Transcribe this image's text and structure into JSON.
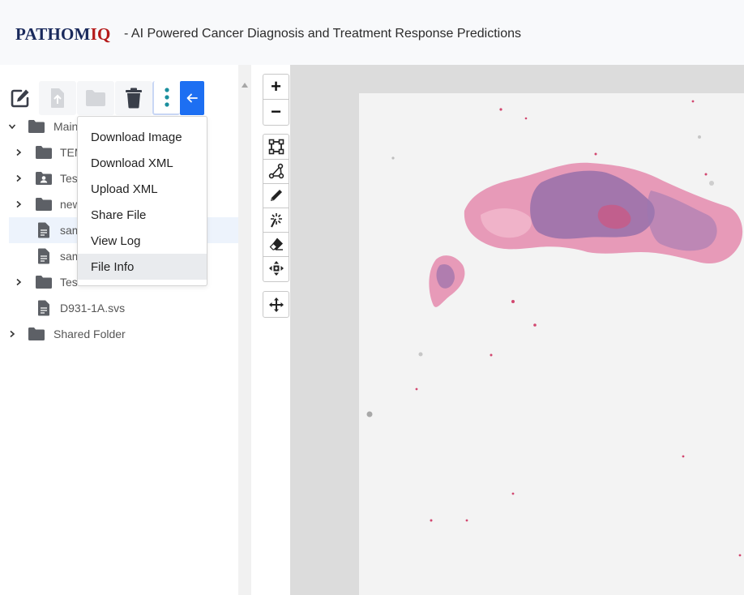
{
  "header": {
    "brand_part1": "PATHOM",
    "brand_part2": "IQ",
    "tagline": "- AI Powered Cancer Diagnosis and Treatment Response Predictions"
  },
  "toolbar": {
    "buttons": [
      {
        "name": "edit",
        "icon": "edit-icon",
        "enabled": true
      },
      {
        "name": "upload",
        "icon": "upload-file-icon",
        "enabled": false
      },
      {
        "name": "new-folder",
        "icon": "folder-icon",
        "enabled": false
      },
      {
        "name": "delete",
        "icon": "trash-icon",
        "enabled": true
      },
      {
        "name": "more",
        "icon": "vertical-dots-icon",
        "enabled": true
      },
      {
        "name": "collapse",
        "icon": "arrow-left-icon",
        "enabled": true
      }
    ]
  },
  "tree": {
    "items": [
      {
        "label": "Main",
        "type": "folder",
        "expanded": true
      },
      {
        "label": "TEM",
        "type": "folder"
      },
      {
        "label": "Tes",
        "type": "shared-folder"
      },
      {
        "label": "new",
        "type": "folder"
      },
      {
        "label": "sam",
        "type": "file",
        "selected": true
      },
      {
        "label": "sam",
        "type": "file"
      },
      {
        "label": "Test",
        "type": "folder"
      },
      {
        "label": "D931-1A.svs",
        "type": "file"
      },
      {
        "label": "Shared Folder",
        "type": "folder"
      }
    ]
  },
  "context_menu": {
    "items": [
      "Download Image",
      "Download XML",
      "Upload XML",
      "Share File",
      "View Log",
      "File Info"
    ],
    "highlighted": "File Info"
  },
  "viewer": {
    "zoom_in": "+",
    "zoom_out": "−",
    "tools": [
      "rectangle-tool-icon",
      "polygon-tool-icon",
      "pencil-icon",
      "magic-wand-icon",
      "eraser-icon",
      "move-points-icon"
    ],
    "pan": "pan-icon"
  },
  "colors": {
    "brand_navy": "#1a2a5c",
    "brand_red": "#b51b1b",
    "accent_blue": "#1d6ff2",
    "tissue_pink": "#e48fb0",
    "tissue_purple": "#7a5aa0"
  }
}
